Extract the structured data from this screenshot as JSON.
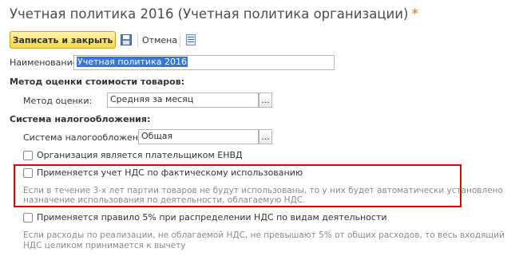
{
  "window": {
    "title": "Учетная политика 2016 (Учетная политика организации)",
    "modified_marker": "*"
  },
  "toolbar": {
    "save_close_label": "Записать и закрыть",
    "save_icon": "floppy-disk-icon",
    "cancel_label": "Отмена",
    "more_icon": "list-icon"
  },
  "form": {
    "name_label": "Наименование:",
    "name_value": "Учетная политика 2016",
    "valuation_section": "Метод оценки стоимости товаров:",
    "valuation_label": "Метод оценки:",
    "valuation_value": "Средняя за месяц",
    "tax_section": "Система налогообложения:",
    "tax_label": "Система налогообложения:",
    "tax_value": "Общая",
    "envd_label": "Организация является плательщиком ЕНВД",
    "envd_checked": false,
    "vat_actual_label": "Применяется учет НДС по фактическому использованию",
    "vat_actual_checked": false,
    "vat_actual_hint_1": "Если в течение 3-х лет партии товаров не будут использованы, то у них будет автоматически установлено",
    "vat_actual_hint_2": "назначение использования по деятельности, облагаемую НДС.",
    "rule5_label": "Применяется правило 5% при распределении НДС по видам деятельности",
    "rule5_checked": false,
    "rule5_hint_1": "Если расходы по реализации, не облагаемой НДС, не превышают 5% от общих расходов, то весь входящий",
    "rule5_hint_2": "НДС целиком принимается к вычету",
    "ellipsis_label": "..."
  },
  "colors": {
    "primary_button": "#f5d94a",
    "highlight_border": "#d90000",
    "selection": "#3875d7"
  }
}
